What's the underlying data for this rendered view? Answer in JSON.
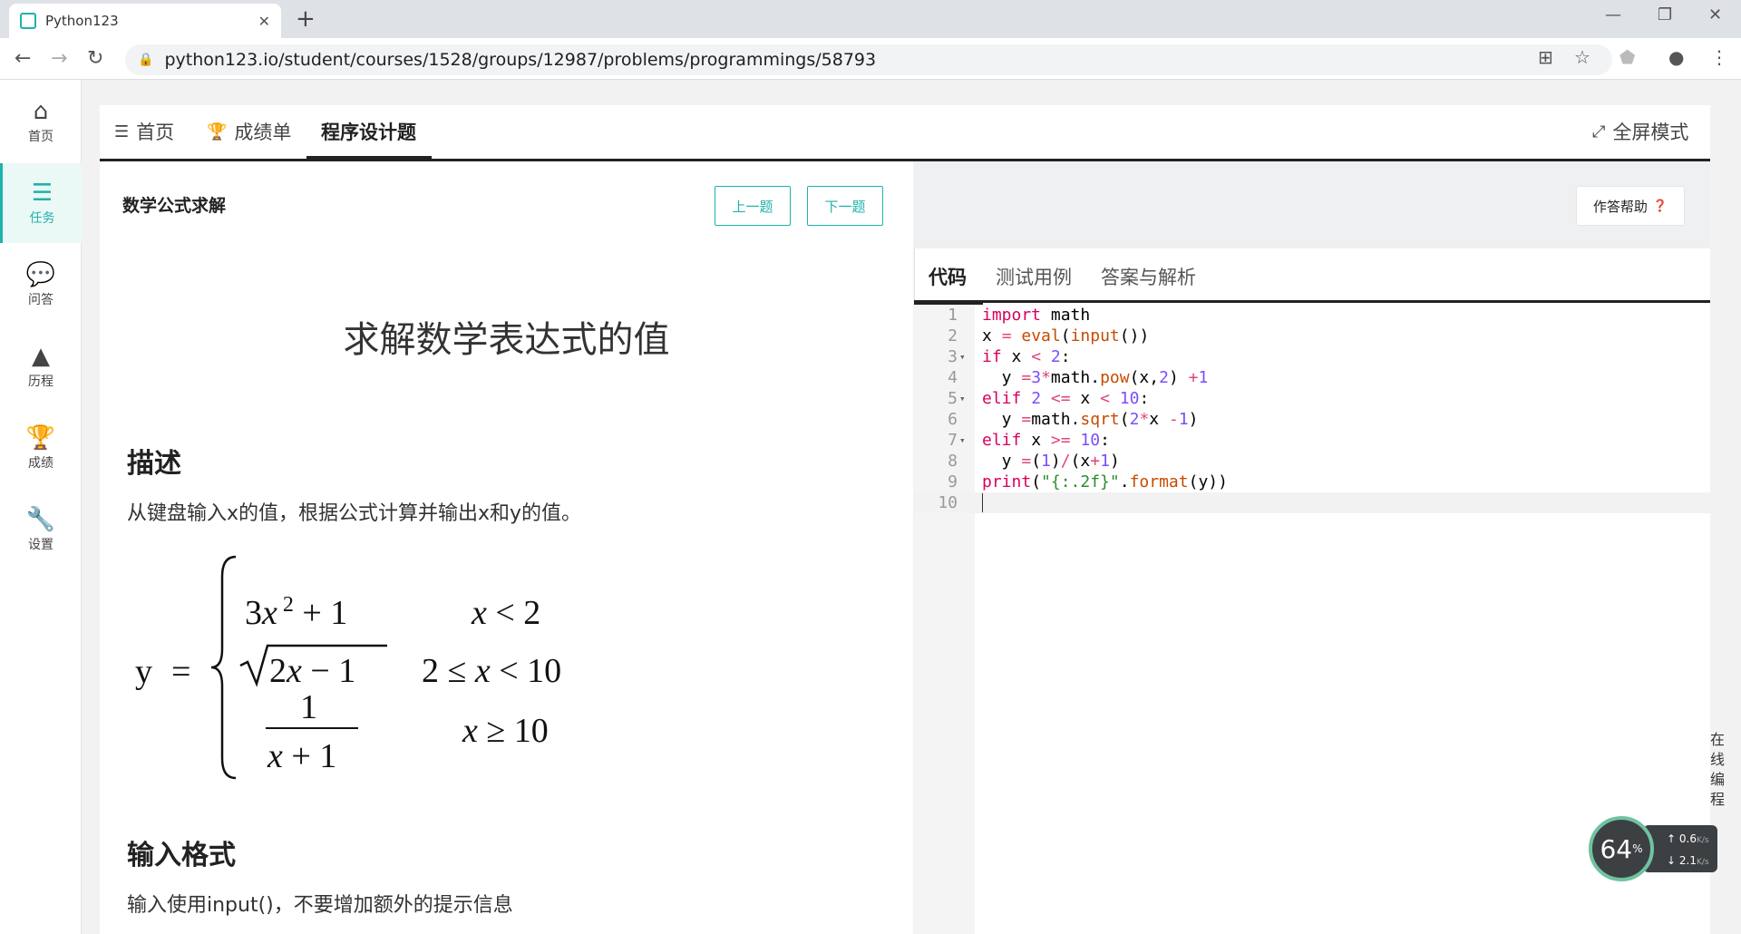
{
  "browser": {
    "tab_title": "Python123",
    "url": "python123.io/student/courses/1528/groups/12987/problems/programmings/58793"
  },
  "sidebar": {
    "items": [
      {
        "label": "首页",
        "icon": "home-icon"
      },
      {
        "label": "任务",
        "icon": "tasks-icon"
      },
      {
        "label": "问答",
        "icon": "chat-icon"
      },
      {
        "label": "历程",
        "icon": "tree-icon"
      },
      {
        "label": "成绩",
        "icon": "trophy-icon"
      },
      {
        "label": "设置",
        "icon": "wrench-icon"
      }
    ]
  },
  "topnav": {
    "home": "首页",
    "scores": "成绩单",
    "programming": "程序设计题",
    "fullscreen": "全屏模式"
  },
  "problem": {
    "title": "数学公式求解",
    "prev": "上一题",
    "next": "下一题",
    "heading": "求解数学表达式的值",
    "desc_title": "描述",
    "desc_text": "从键盘输入x的值，根据公式计算并输出x和y的值。",
    "input_title": "输入格式",
    "input_text": "输入使用input()，不要增加额外的提示信息"
  },
  "formula": {
    "lhs": "y",
    "cases": [
      {
        "expr": "3x² + 1",
        "cond": "x < 2"
      },
      {
        "expr": "√(2x − 1)",
        "cond": "2 ≤ x < 10"
      },
      {
        "expr": "1/(x + 1)",
        "cond": "x ≥ 10"
      }
    ]
  },
  "editor": {
    "help": "作答帮助",
    "tabs": [
      "代码",
      "测试用例",
      "答案与解析"
    ],
    "lines": [
      "import math",
      "x = eval(input())",
      "if x < 2:",
      "  y =3*math.pow(x,2) +1",
      "elif 2 <= x < 10:",
      "  y =math.sqrt(2*x -1)",
      "elif x >= 10:",
      "  y =(1)/(x+1)",
      "print(\"{:.2f}\".format(y))",
      ""
    ],
    "line_numbers": [
      "1",
      "2",
      "3",
      "4",
      "5",
      "6",
      "7",
      "8",
      "9",
      "10"
    ]
  },
  "widgets": {
    "online": "在线编程",
    "cpu": "64",
    "cpu_unit": "%",
    "up": "0.6",
    "down": "2.1",
    "rate_unit": "K/s"
  },
  "colors": {
    "accent": "#20b2aa"
  }
}
